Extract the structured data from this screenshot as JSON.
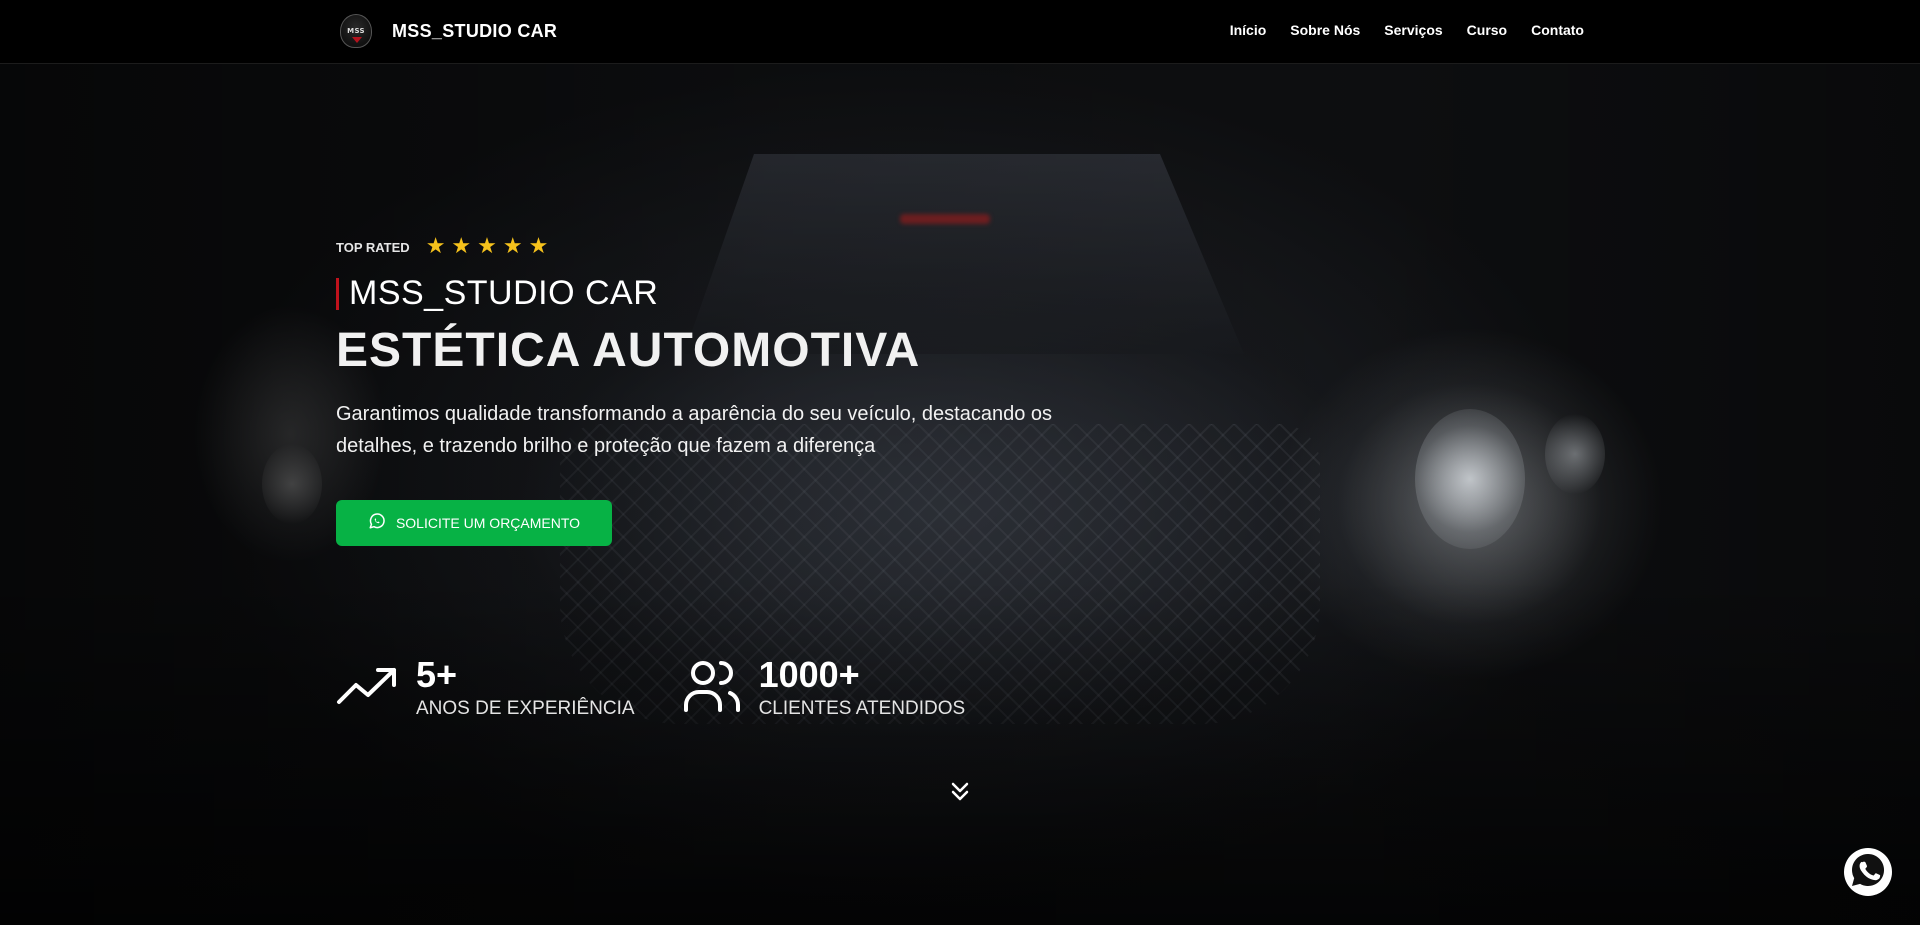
{
  "header": {
    "brand": "MSS_STUDIO CAR",
    "logo_text": "MSS",
    "nav": [
      {
        "label": "Início"
      },
      {
        "label": "Sobre Nós"
      },
      {
        "label": "Serviços"
      },
      {
        "label": "Curso"
      },
      {
        "label": "Contato"
      }
    ]
  },
  "hero": {
    "rating_label": "TOP RATED",
    "stars": 5,
    "subtitle": "MSS_STUDIO CAR",
    "headline": "ESTÉTICA AUTOMOTIVA",
    "description": "Garantimos qualidade transformando a aparência do seu veículo, destacando os detalhes, e trazendo brilho e proteção que fazem a diferença",
    "cta_label": "SOLICITE UM ORÇAMENTO",
    "cta_icon": "whatsapp-icon"
  },
  "stats": [
    {
      "value": "5+",
      "label": "ANOS DE EXPERIÊNCIA",
      "icon": "trending-up-icon"
    },
    {
      "value": "1000+",
      "label": "CLIENTES ATENDIDOS",
      "icon": "users-icon"
    }
  ],
  "colors": {
    "accent_green": "#07b245",
    "star_yellow": "#f6c21c",
    "accent_red": "#c0121c",
    "header_bg": "#000000"
  },
  "floating_button": {
    "icon": "whatsapp-icon"
  }
}
